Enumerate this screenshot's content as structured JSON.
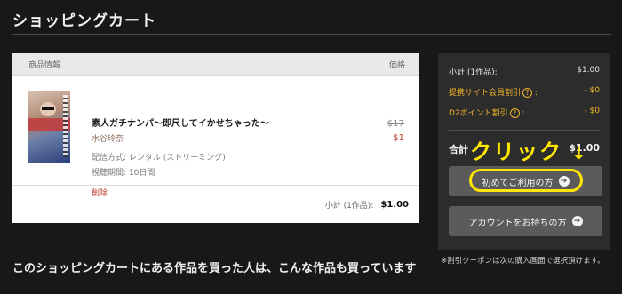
{
  "page": {
    "title": "ショッピングカート"
  },
  "cart": {
    "header_product": "商品情報",
    "header_price": "価格",
    "item": {
      "title": "素人ガチナンパ～即尺してイかせちゃった～",
      "actress": "水谷玲奈",
      "delivery": "配信方式: レンタル (ストリーミング)",
      "period": "視聴期間: 10日間",
      "delete": "削除",
      "price_original": "$17",
      "price_sale": "$1"
    },
    "footer_label": "小計 (1作品):",
    "footer_value": "$1.00"
  },
  "summary": {
    "subtotal_label": "小計 (1作品):",
    "subtotal_value": "$1.00",
    "affiliate_discount_label": "提携サイト会員割引",
    "affiliate_discount_value": "- $0",
    "d2_points_label": "D2ポイント割引",
    "d2_points_value": "- $0",
    "total_label": "合計",
    "total_value": "$1.00",
    "first_time_button": "初めてご利用の方",
    "account_button": "アカウントをお持ちの方",
    "coupon_note": "※割引クーポンは次の購入画面で選択頂けます。"
  },
  "annotation": {
    "click_text": "クリック",
    "arrow": "↓"
  },
  "recommend": {
    "heading": "このショッピングカートにある作品を買った人は、こんな作品も買っています"
  },
  "colors": {
    "background": "#181818",
    "accent_yellow": "#ffe600",
    "discount_orange": "#f0b429",
    "sale_red": "#c0392b"
  },
  "icons": {
    "button_arrow": "arrow-right-circle-icon",
    "help": "question-circle-icon"
  }
}
